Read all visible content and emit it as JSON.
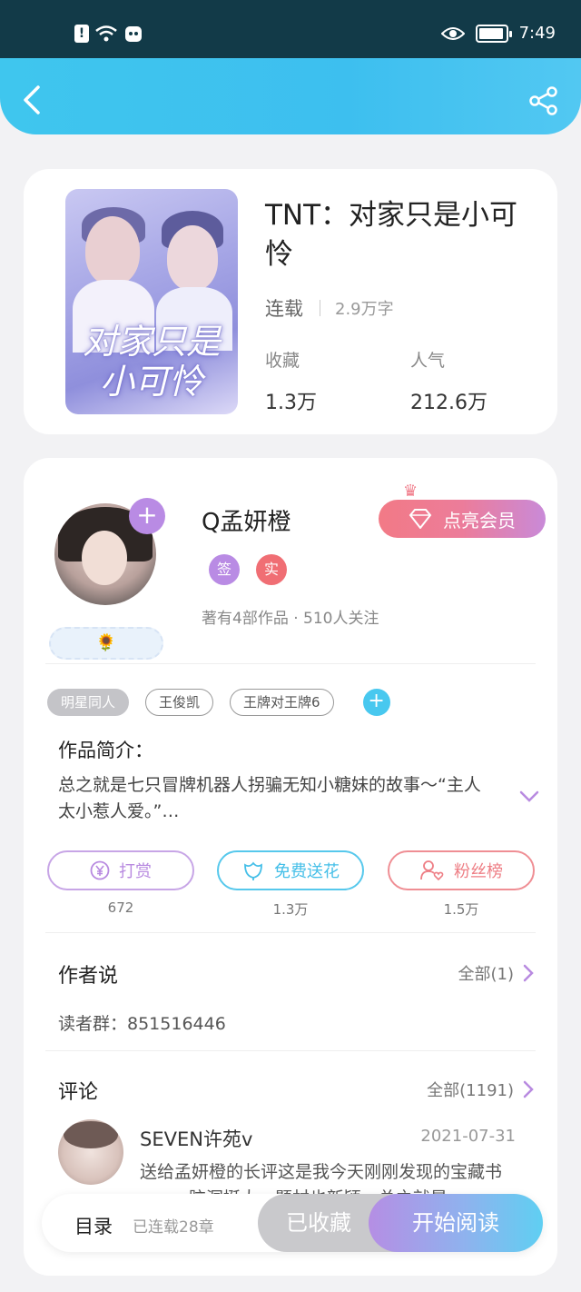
{
  "status_bar": {
    "time": "7:49",
    "left_icons": [
      "alert-icon",
      "wifi-icon",
      "app-notification-icon"
    ],
    "right_icons": [
      "eye-icon",
      "battery-icon"
    ]
  },
  "header": {
    "back_icon": "back-arrow-icon",
    "share_icon": "share-icon",
    "accent_color": "#3fc6ee"
  },
  "book": {
    "title": "TNT：对家只是小可怜",
    "cover_title": "对家只是小可怜",
    "status": "连载",
    "word_count": "2.9万字",
    "favorites_label": "收藏",
    "favorites_value": "1.3万",
    "popularity_label": "人气",
    "popularity_value": "212.6万"
  },
  "author": {
    "name": "Q孟妍橙",
    "badge_signed": "签",
    "badge_verified": "实",
    "meta": "著有4部作品 · 510人关注",
    "vip_button": "点亮会员",
    "flower_badge": "🌻"
  },
  "tags": [
    {
      "label": "明星同人",
      "style": "filled"
    },
    {
      "label": "王俊凯",
      "style": "outline"
    },
    {
      "label": "王牌对王牌6",
      "style": "outline"
    }
  ],
  "intro": {
    "title": "作品简介：",
    "text": "总之就是七只冒牌机器人拐骗无知小糖妹的故事～“主人太小惹人爱。”…"
  },
  "actions": [
    {
      "label": "打赏",
      "count": "672",
      "icon": "yen-coin-icon"
    },
    {
      "label": "免费送花",
      "count": "1.3万",
      "icon": "flower-icon"
    },
    {
      "label": "粉丝榜",
      "count": "1.5万",
      "icon": "fans-heart-icon"
    }
  ],
  "author_says": {
    "title": "作者说",
    "more": "全部(1)",
    "reader_group": "读者群：851516446"
  },
  "comments": {
    "title": "评论",
    "more": "全部(1191)",
    "items": [
      {
        "user": "SEVEN许苑v",
        "date": "2021-07-31",
        "text": "送给孟妍橙的长评这是我今天刚刚发现的宝藏书ooo，脑洞挺大，题材也新颖，总之就是"
      }
    ]
  },
  "bottom_bar": {
    "toc": "目录",
    "toc_count": "已连载28章",
    "collected": "已收藏",
    "read": "开始阅读"
  }
}
